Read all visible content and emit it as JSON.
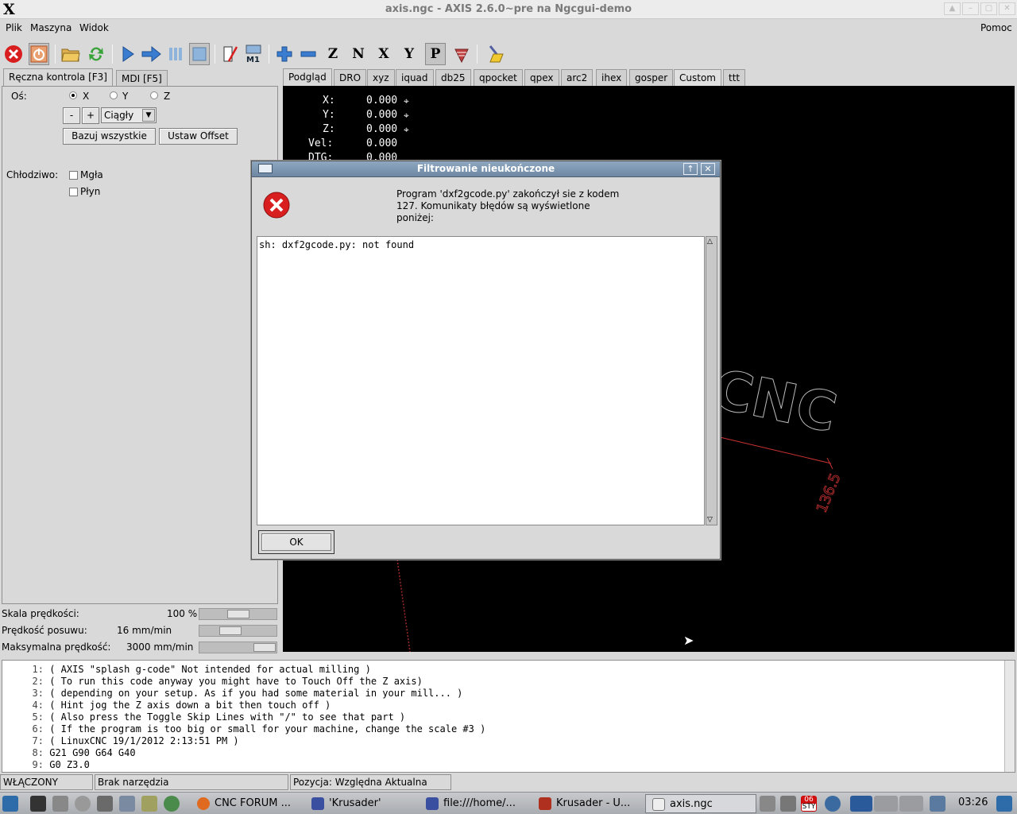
{
  "window": {
    "title": "axis.ngc - AXIS 2.6.0~pre na Ngcgui-demo",
    "logo": "X"
  },
  "menu": {
    "items": [
      "Plik",
      "Maszyna",
      "Widok"
    ],
    "help": "Pomoc"
  },
  "toolbar": {
    "icons": [
      "estop-icon",
      "power-icon",
      "open-file-icon",
      "reload-icon",
      "run-icon",
      "step-icon",
      "pause-icon",
      "stop-icon",
      "skip-lines-icon",
      "optional-stop-icon",
      "zoom-in-icon",
      "zoom-out-icon",
      "view-z-icon",
      "view-z2-icon",
      "view-x-icon",
      "view-y-icon",
      "view-p-icon",
      "rotate-view-icon",
      "clear-plot-icon"
    ],
    "labels": {
      "z": "Z",
      "z2": "N",
      "x": "X",
      "y": "Y",
      "p": "P",
      "m1": "M1"
    }
  },
  "left_tabs": [
    "Ręczna kontrola [F3]",
    "MDI [F5]"
  ],
  "manual": {
    "axis_label": "Oś:",
    "axes": [
      "X",
      "Y",
      "Z"
    ],
    "selected_axis": "X",
    "minus": "-",
    "plus": "+",
    "jog_mode": "Ciągły",
    "home_all": "Bazuj wszystkie",
    "set_offset": "Ustaw Offset",
    "coolant_label": "Chłodziwo:",
    "mist": "Mgła",
    "flood": "Płyn"
  },
  "sliders": {
    "feed_override_label": "Skala prędkości:",
    "feed_override_value": "100 %",
    "jog_speed_label": "Prędkość posuwu:",
    "jog_speed_value": "16 mm/min",
    "max_velocity_label": "Maksymalna prędkość:",
    "max_velocity_value": "3000 mm/min"
  },
  "right_tabs": [
    "Podgląd",
    "DRO",
    "xyz",
    "iquad",
    "db25",
    "qpocket",
    "qpex",
    "arc2",
    "ihex",
    "gosper",
    "Custom",
    "ttt"
  ],
  "dro": [
    {
      "label": "X:",
      "value": "0.000"
    },
    {
      "label": "Y:",
      "value": "0.000"
    },
    {
      "label": "Z:",
      "value": "0.000"
    },
    {
      "label": "Vel:",
      "value": "0.000"
    },
    {
      "label": "DTG:",
      "value": "0.000"
    }
  ],
  "preview_text": {
    "logo": "CNC",
    "dimension": "136.5"
  },
  "dialog": {
    "title": "Filtrowanie nieukończone",
    "message_lines": [
      "Program 'dxf2gcode.py' zakończył sie z kodem",
      "127. Komunikaty błędów są wyświetlone",
      "poniżej:"
    ],
    "output": "sh: dxf2gcode.py: not found",
    "ok": "OK",
    "maximize": "↑",
    "close": "✕"
  },
  "gcode": [
    {
      "n": "1:",
      "text": "( AXIS \"splash g-code\" Not intended for actual milling )"
    },
    {
      "n": "2:",
      "text": "( To run this code anyway you might have to Touch Off the Z axis)"
    },
    {
      "n": "3:",
      "text": "( depending on your setup. As if you had some material in your mill... )"
    },
    {
      "n": "4:",
      "text": "( Hint jog the Z axis down a bit then touch off )"
    },
    {
      "n": "5:",
      "text": "( Also press the Toggle Skip Lines with \"/\" to see that part )"
    },
    {
      "n": "6:",
      "text": "( If the program is too big or small for your machine, change the scale #3 )"
    },
    {
      "n": "7:",
      "text": "( LinuxCNC 19/1/2012 2:13:51 PM )"
    },
    {
      "n": "8:",
      "text": "G21 G90 G64 G40"
    },
    {
      "n": "9:",
      "text": "G0 Z3.0"
    }
  ],
  "status": {
    "machine": "WŁĄCZONY",
    "tool": "Brak narzędzia",
    "position": "Pozycja: Względna Aktualna"
  },
  "taskbar": {
    "tasks": [
      "CNC FORUM ...",
      "'Krusader'",
      "file:///home/...",
      "Krusader - U...",
      "axis.ngc"
    ],
    "active_task": "axis.ngc",
    "calendar": {
      "day": "06",
      "month": "STY"
    },
    "clock": "03:26"
  },
  "colors": {
    "preview_bg": "#000000",
    "dialog_title": "#7890ab",
    "error_icon": "#d81e1e",
    "dimension_line": "#c83232"
  }
}
